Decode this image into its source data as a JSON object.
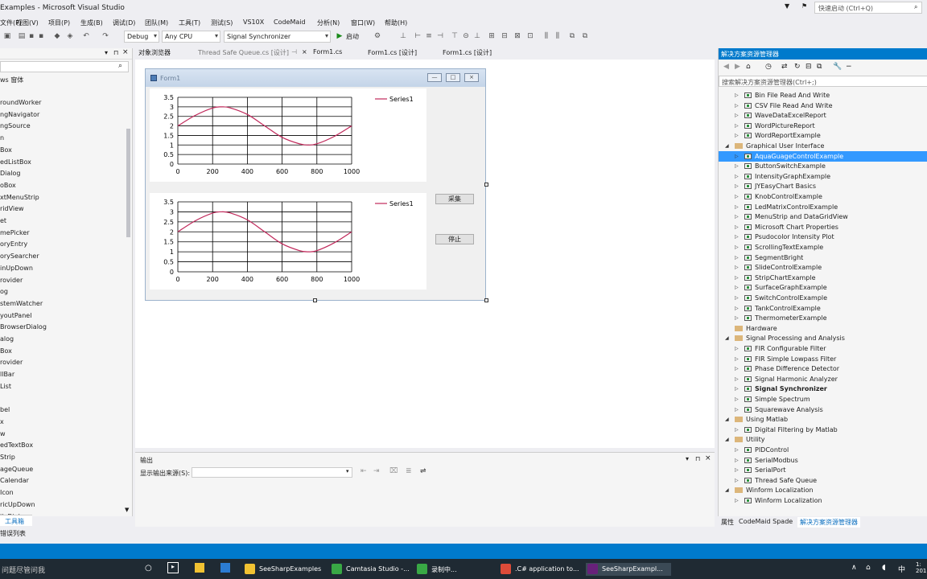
{
  "window": {
    "title": "Examples - Microsoft Visual Studio",
    "quick_launch": "快速启动 (Ctrl+Q)"
  },
  "menu": [
    "文件(F)",
    "视图(V)",
    "项目(P)",
    "生成(B)",
    "调试(D)",
    "团队(M)",
    "工具(T)",
    "测试(S)",
    "VS10X",
    "CodeMaid",
    "分析(N)",
    "窗口(W)",
    "帮助(H)"
  ],
  "toolbar": {
    "config": "Debug",
    "platform": "Any CPU",
    "project": "Signal Synchronizer",
    "start": "启动"
  },
  "toolbox": {
    "group": "ws 窗体",
    "items": [
      "roundWorker",
      "ngNavigator",
      "ngSource",
      "n",
      "Box",
      "edListBox",
      "Dialog",
      "oBox",
      "xtMenuStrip",
      "ridView",
      "et",
      "mePicker",
      "oryEntry",
      "orySearcher",
      "inUpDown",
      "rovider",
      "og",
      "stemWatcher",
      "youtPanel",
      "BrowserDialog",
      "alog",
      "Box",
      "rovider",
      "llBar",
      "List",
      "",
      "bel",
      "x",
      "w",
      "edTextBox",
      "Strip",
      "ageQueue",
      "Calendar",
      "Icon",
      "ricUpDown",
      "ileDialog"
    ],
    "tab_label": "工具箱",
    "error_list": "错误列表"
  },
  "doc_tabs": [
    "对象浏览器",
    "Thread Safe Queue.cs [设计]",
    "Form1.cs",
    "Form1.cs [设计]",
    "Form1.cs [设计]"
  ],
  "form": {
    "title": "Form1",
    "button_collect": "采集",
    "button_stop": "停止",
    "legend1": "Series1",
    "legend2": "Series1"
  },
  "chart_data": [
    {
      "type": "line",
      "series": [
        {
          "name": "Series1",
          "x": [
            0,
            100,
            200,
            250,
            300,
            400,
            500,
            600,
            700,
            750,
            800,
            900,
            1000
          ],
          "y": [
            2,
            2.55,
            2.94,
            3.0,
            2.95,
            2.6,
            2.0,
            1.4,
            1.06,
            1.0,
            1.06,
            1.45,
            2.0
          ]
        }
      ],
      "xlim": [
        0,
        1000
      ],
      "ylim": [
        0,
        3.5
      ],
      "xticks": [
        "0",
        "200",
        "400",
        "600",
        "800",
        "1000"
      ],
      "yticks": [
        "0",
        "0.5",
        "1",
        "1.5",
        "2",
        "2.5",
        "3",
        "3.5"
      ],
      "grid": true,
      "legend": "top-right",
      "color": "#c0285a"
    },
    {
      "type": "line",
      "series": [
        {
          "name": "Series1",
          "x": [
            0,
            100,
            200,
            250,
            300,
            400,
            500,
            600,
            700,
            750,
            800,
            900,
            1000
          ],
          "y": [
            2,
            2.55,
            2.94,
            3.0,
            2.95,
            2.6,
            2.0,
            1.4,
            1.06,
            1.0,
            1.06,
            1.45,
            2.0
          ]
        }
      ],
      "xlim": [
        0,
        1000
      ],
      "ylim": [
        0,
        3.5
      ],
      "xticks": [
        "0",
        "200",
        "400",
        "600",
        "800",
        "1000"
      ],
      "yticks": [
        "0",
        "0.5",
        "1",
        "1.5",
        "2",
        "2.5",
        "3",
        "3.5"
      ],
      "grid": true,
      "legend": "top-right",
      "color": "#c0285a"
    }
  ],
  "output": {
    "title": "输出",
    "source_label": "显示输出来源(S):",
    "source_value": ""
  },
  "solution": {
    "title": "解决方案资源管理器",
    "search": "搜索解决方案资源管理器(Ctrl+;)",
    "tabs": [
      "属性",
      "CodeMaid Spade",
      "解决方案资源管理器"
    ],
    "items": [
      {
        "label": "Bin File Read And Write",
        "level": 2
      },
      {
        "label": "CSV File Read And Write",
        "level": 2
      },
      {
        "label": "WaveDataExcelReport",
        "level": 2
      },
      {
        "label": "WordPictureReport",
        "level": 2
      },
      {
        "label": "WordReportExample",
        "level": 2
      },
      {
        "label": "Graphical User Interface",
        "level": 1
      },
      {
        "label": "AquaGuageControlExample",
        "level": 2,
        "selected": true
      },
      {
        "label": "ButtonSwitchExample",
        "level": 2
      },
      {
        "label": "IntensityGraphExample",
        "level": 2
      },
      {
        "label": "JYEasyChart Basics",
        "level": 2
      },
      {
        "label": "KnobControlExample",
        "level": 2
      },
      {
        "label": "LedMatrixControlExample",
        "level": 2
      },
      {
        "label": "MenuStrip and DataGridView",
        "level": 2
      },
      {
        "label": "Microsoft Chart Properties",
        "level": 2
      },
      {
        "label": "Psudocolor Intensity Plot",
        "level": 2
      },
      {
        "label": "ScrollingTextExample",
        "level": 2
      },
      {
        "label": "SegmentBright",
        "level": 2
      },
      {
        "label": "SlideControlExample",
        "level": 2
      },
      {
        "label": "StripChartExample",
        "level": 2
      },
      {
        "label": "SurfaceGraphExample",
        "level": 2
      },
      {
        "label": "SwitchControlExample",
        "level": 2
      },
      {
        "label": "TankControlExample",
        "level": 2
      },
      {
        "label": "ThermometerExample",
        "level": 2
      },
      {
        "label": "Hardware",
        "level": 1,
        "leaf": true
      },
      {
        "label": "Signal Processing and Analysis",
        "level": 1
      },
      {
        "label": "FIR Configurable Filter",
        "level": 2
      },
      {
        "label": "FIR Simple Lowpass Filter",
        "level": 2
      },
      {
        "label": "Phase Difference Detector",
        "level": 2
      },
      {
        "label": "Signal Harmonic Analyzer",
        "level": 2
      },
      {
        "label": "Signal Synchronizer",
        "level": 2,
        "bold": true
      },
      {
        "label": "Simple Spectrum",
        "level": 2
      },
      {
        "label": "Squarewave Analysis",
        "level": 2
      },
      {
        "label": "Using Matlab",
        "level": 1
      },
      {
        "label": "Digital Filtering by Matlab",
        "level": 2
      },
      {
        "label": "Utility",
        "level": 1
      },
      {
        "label": "PIDControl",
        "level": 2
      },
      {
        "label": "SerialModbus",
        "level": 2
      },
      {
        "label": "SerialPort",
        "level": 2
      },
      {
        "label": "Thread Safe Queue",
        "level": 2
      },
      {
        "label": "Winform Localization",
        "level": 1
      },
      {
        "label": "Winform Localization",
        "level": 2
      }
    ]
  },
  "taskbar": {
    "search": "问题尽管问我",
    "apps": [
      "SeeSharpExamples",
      "Camtasia Studio -...",
      "录制中...",
      ".C# application to...",
      "SeeSharpExampl..."
    ],
    "clock": "1: 201"
  },
  "colors": {
    "accent": "#007acc",
    "selection": "#3399ff",
    "series": "#c0285a"
  }
}
